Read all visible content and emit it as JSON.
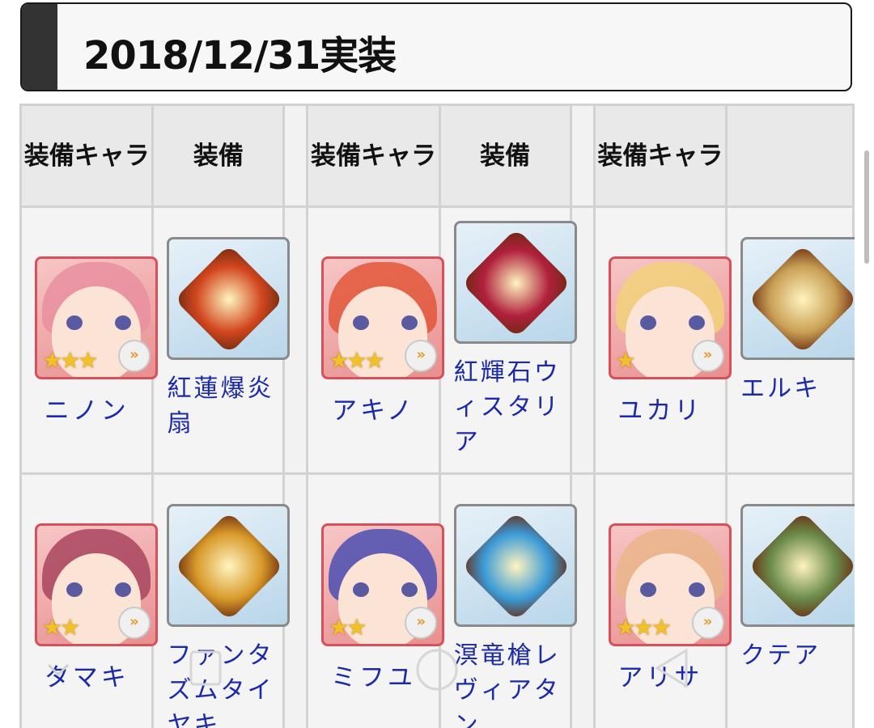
{
  "title": "2018/12/31実装",
  "headers": [
    "装備キャラ",
    "装備",
    "装備キャラ",
    "装備",
    "装備キャラ"
  ],
  "rows": [
    [
      {
        "character": {
          "name": "ニノン",
          "stars": "★★★",
          "rank_icon": "rank-chevron-icon",
          "color": "#e98fa0"
        },
        "equipment": {
          "name": "紅蓮爆炎扇",
          "color": "#d2461e"
        }
      },
      {
        "character": {
          "name": "アキノ",
          "stars": "★★★",
          "rank_icon": "rank-chevron-icon",
          "color": "#e2563a"
        },
        "equipment": {
          "name": "紅輝石ウィスタリア",
          "color": "#b0203c"
        }
      },
      {
        "character": {
          "name": "ユカリ",
          "stars": "★",
          "rank_icon": "rank-chevron-icon",
          "color": "#f1d27a"
        },
        "equipment": {
          "name": "エルキ",
          "color": "#c9a055"
        }
      }
    ],
    [
      {
        "character": {
          "name": "タマキ",
          "stars": "★★",
          "rank_icon": "rank-chevron-icon",
          "color": "#a8445e"
        },
        "equipment": {
          "name": "ファンタズムタイヤキ",
          "color": "#d89a2a"
        }
      },
      {
        "character": {
          "name": "ミフユ",
          "stars": "★★",
          "rank_icon": "rank-chevron-icon",
          "color": "#4a4fb2"
        },
        "equipment": {
          "name": "溟竜槍レヴィアタン",
          "color": "#3a9ad6"
        }
      },
      {
        "character": {
          "name": "アリサ",
          "stars": "★★★",
          "rank_icon": "rank-chevron-icon",
          "color": "#e9b58a"
        },
        "equipment": {
          "name": "クテア",
          "color": "#6a8a4a"
        }
      }
    ]
  ],
  "rank_glyph": "»"
}
